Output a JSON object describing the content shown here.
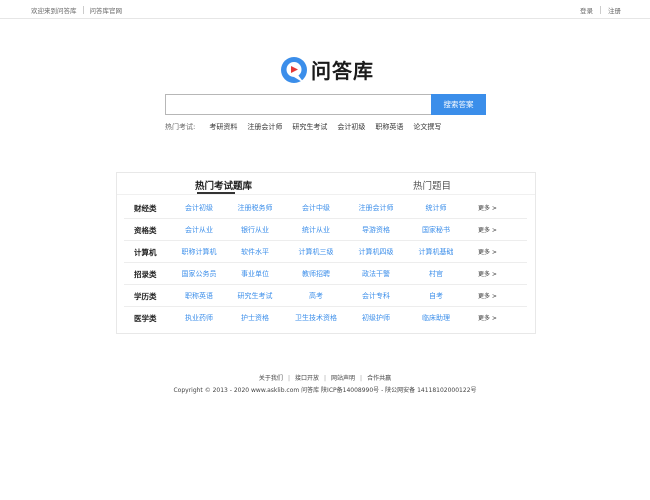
{
  "topbar": {
    "welcome": "欢迎来到问答库",
    "official_site": "问答库官网",
    "login": "登录",
    "register": "注册"
  },
  "logo": {
    "text": "问答库",
    "brand_color": "#3b8eea",
    "accent_color": "#e53935",
    "icon": "qa-logo-icon"
  },
  "search": {
    "placeholder": "",
    "value": "",
    "button_label": "搜索答案"
  },
  "hot": {
    "label": "热门考试:",
    "items": [
      "考研资料",
      "注册会计师",
      "研究生考试",
      "会计初级",
      "职称英语",
      "论文撰写"
    ]
  },
  "panel": {
    "tabs": [
      "热门考试题库",
      "热门题目"
    ],
    "more_label": "更多 >",
    "rows": [
      {
        "category": "财经类",
        "items": [
          "会计初级",
          "注册税务师",
          "会计中级",
          "注册会计师",
          "统计师"
        ]
      },
      {
        "category": "资格类",
        "items": [
          "会计从业",
          "银行从业",
          "统计从业",
          "导游资格",
          "国家秘书"
        ]
      },
      {
        "category": "计算机",
        "items": [
          "职称计算机",
          "软件水平",
          "计算机三级",
          "计算机四级",
          "计算机基础"
        ]
      },
      {
        "category": "招录类",
        "items": [
          "国家公务员",
          "事业单位",
          "教师招聘",
          "政法干警",
          "村官"
        ]
      },
      {
        "category": "学历类",
        "items": [
          "职称英语",
          "研究生考试",
          "高考",
          "会计专科",
          "自考"
        ]
      },
      {
        "category": "医学类",
        "items": [
          "执业药师",
          "护士资格",
          "卫生技术资格",
          "初级护师",
          "临床助理"
        ]
      }
    ]
  },
  "footer": {
    "links": [
      "关于我们",
      "接口开放",
      "网站声明",
      "合作共赢"
    ],
    "copyright": "Copyright © 2013 - 2020 www.asklib.com  问答库  陕ICP备14008990号 - 陕公网安备 14118102000122号"
  }
}
